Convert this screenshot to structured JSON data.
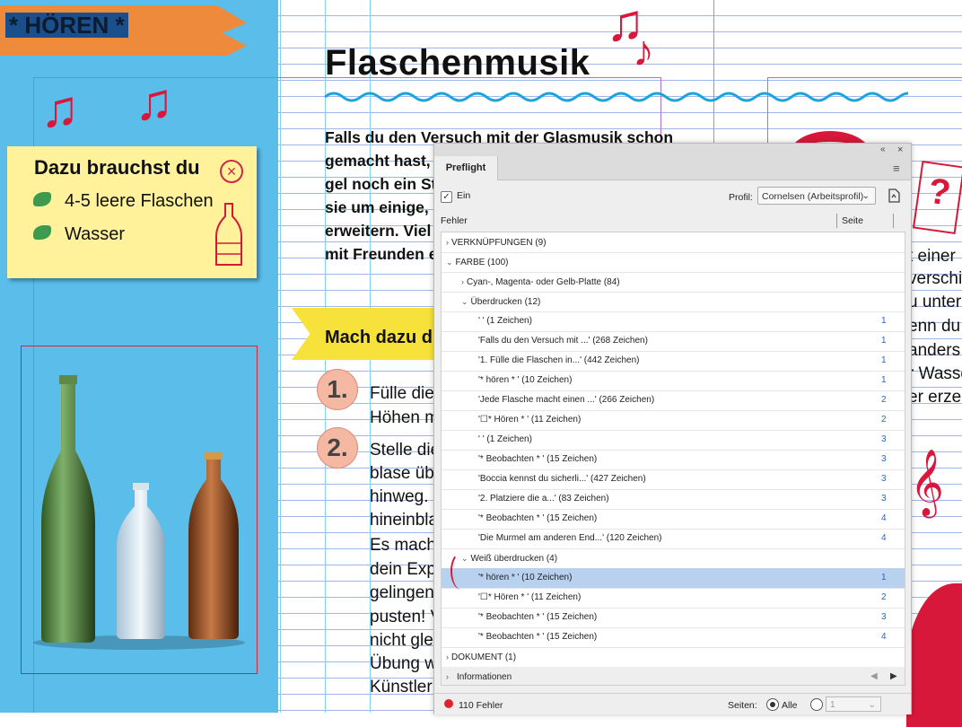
{
  "document": {
    "banner_label": "* HÖREN *",
    "title": "Flaschenmusik",
    "intro_lines": [
      "Falls du den Versuch mit der Glasmusik schon",
      "gemacht hast, k",
      "gel noch ein Sti",
      "sie um einige, e",
      "erweitern. Viel",
      "mit Freunden e"
    ],
    "materials": {
      "title": "Dazu brauchst du",
      "items": [
        "4-5 leere Flaschen",
        "Wasser"
      ]
    },
    "action_heading": "Mach dazu d",
    "steps": [
      {
        "number": "1.",
        "lines": [
          "Fülle die",
          "Höhen m"
        ]
      },
      {
        "number": "2.",
        "lines": [
          "Stelle die",
          "blase üb",
          "hinweg.",
          "hineinbla",
          "Es mach",
          "dein Exp",
          "gelingen",
          "pusten! V",
          "nicht gle",
          "Übung w",
          "Künstler"
        ]
      }
    ],
    "right_column_lines": [
      "t einer",
      "verschie",
      "u unter",
      "enn du",
      "anders",
      "r Wasse",
      "er erze"
    ]
  },
  "preflight": {
    "tab_label": "Preflight",
    "collapse_icon": "«",
    "close_icon": "×",
    "menu_icon": "≡",
    "on_label": "Ein",
    "on_checked": true,
    "profile_label": "Profil:",
    "profile_value": "Cornelsen (Arbeitsprofil)",
    "col_error": "Fehler",
    "col_page": "Seite",
    "rows": [
      {
        "label": "VERKNÜPFUNGEN (9)",
        "twisty": "›",
        "page": ""
      },
      {
        "label": "FARBE (100)",
        "twisty": "⌄",
        "page": ""
      },
      {
        "label": "Cyan-, Magenta- oder Gelb-Platte (84)",
        "twisty": "›",
        "page": ""
      },
      {
        "label": "Überdrucken (12)",
        "twisty": "⌄",
        "page": ""
      },
      {
        "label": "' ' (1 Zeichen)",
        "twisty": "",
        "page": "1"
      },
      {
        "label": "'Falls du den Versuch mit ...' (268 Zeichen)",
        "twisty": "",
        "page": "1"
      },
      {
        "label": "'1. Fülle die Flaschen in...' (442 Zeichen)",
        "twisty": "",
        "page": "1"
      },
      {
        "label": "'* hören * ' (10 Zeichen)",
        "twisty": "",
        "page": "1"
      },
      {
        "label": "'Jede Flasche macht einen ...' (266 Zeichen)",
        "twisty": "",
        "page": "2"
      },
      {
        "label": "'☐* Hören * ' (11 Zeichen)",
        "twisty": "",
        "page": "2"
      },
      {
        "label": "' ' (1 Zeichen)",
        "twisty": "",
        "page": "3"
      },
      {
        "label": "'* Beobachten * ' (15 Zeichen)",
        "twisty": "",
        "page": "3"
      },
      {
        "label": "'Boccia kennst du sicherli...' (427 Zeichen)",
        "twisty": "",
        "page": "3"
      },
      {
        "label": "'2.   Platziere die a...' (83 Zeichen)",
        "twisty": "",
        "page": "3"
      },
      {
        "label": "'* Beobachten * ' (15 Zeichen)",
        "twisty": "",
        "page": "4"
      },
      {
        "label": "'Die Murmel am anderen End...' (120 Zeichen)",
        "twisty": "",
        "page": "4"
      },
      {
        "label": "Weiß überdrucken (4)",
        "twisty": "⌄",
        "page": ""
      },
      {
        "label": "'* hören * ' (10 Zeichen)",
        "twisty": "",
        "page": "1"
      },
      {
        "label": "'☐* Hören * ' (11 Zeichen)",
        "twisty": "",
        "page": "2"
      },
      {
        "label": "'* Beobachten * ' (15 Zeichen)",
        "twisty": "",
        "page": "3"
      },
      {
        "label": "'* Beobachten * ' (15 Zeichen)",
        "twisty": "",
        "page": "4"
      },
      {
        "label": "DOKUMENT (1)",
        "twisty": "›",
        "page": ""
      }
    ],
    "info_label": "Informationen",
    "info_twisty": "›",
    "error_count": "110 Fehler",
    "pages_label": "Seiten:",
    "all_label": "Alle",
    "range_value": "1",
    "colors": {
      "selected_row": "#b8d1ee",
      "error_dot": "#e0242e",
      "page_link": "#2a63c8"
    }
  }
}
